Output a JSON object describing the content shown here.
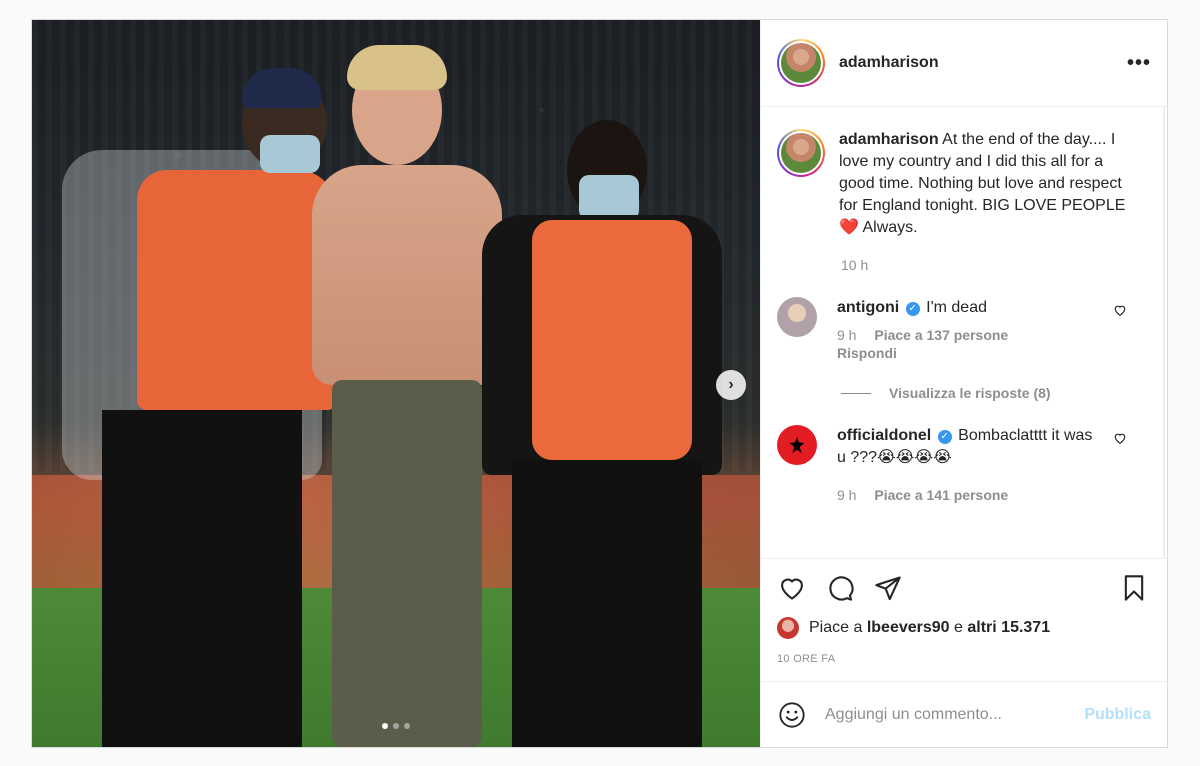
{
  "post": {
    "username": "adamharison",
    "more_label": "•••",
    "caption": "At the end of the day.... I love my country and I did this all for a good time. Nothing but love and respect for England tonight. BIG LOVE PEOPLE❤️ Always.",
    "caption_time": "10 h",
    "media": {
      "next_label": "›",
      "carousel_dots": 3,
      "active_dot": 1
    }
  },
  "comments": [
    {
      "username": "antigoni",
      "verified": true,
      "text": "I'm dead",
      "time": "9 h",
      "likes": "Piace a 137 persone",
      "reply": "Rispondi",
      "view_replies": "Visualizza le risposte (8)"
    },
    {
      "username": "officialdonel",
      "verified": true,
      "text": "Bombaclatttt it was u ???😭😭😭😭",
      "time": "9 h",
      "likes": "Piace a 141 persone"
    }
  ],
  "likes_line": {
    "prefix": "Piace a",
    "user": "lbeevers90",
    "conjunction": "e",
    "others": "altri 15.371"
  },
  "post_age": "10 ORE FA",
  "add_comment": {
    "placeholder": "Aggiungi un commento...",
    "publish_label": "Pubblica"
  },
  "colors": {
    "verified": "#3897f0",
    "publish_disabled": "#b2dffc",
    "muted": "#8e8e8e",
    "text": "#262626"
  }
}
